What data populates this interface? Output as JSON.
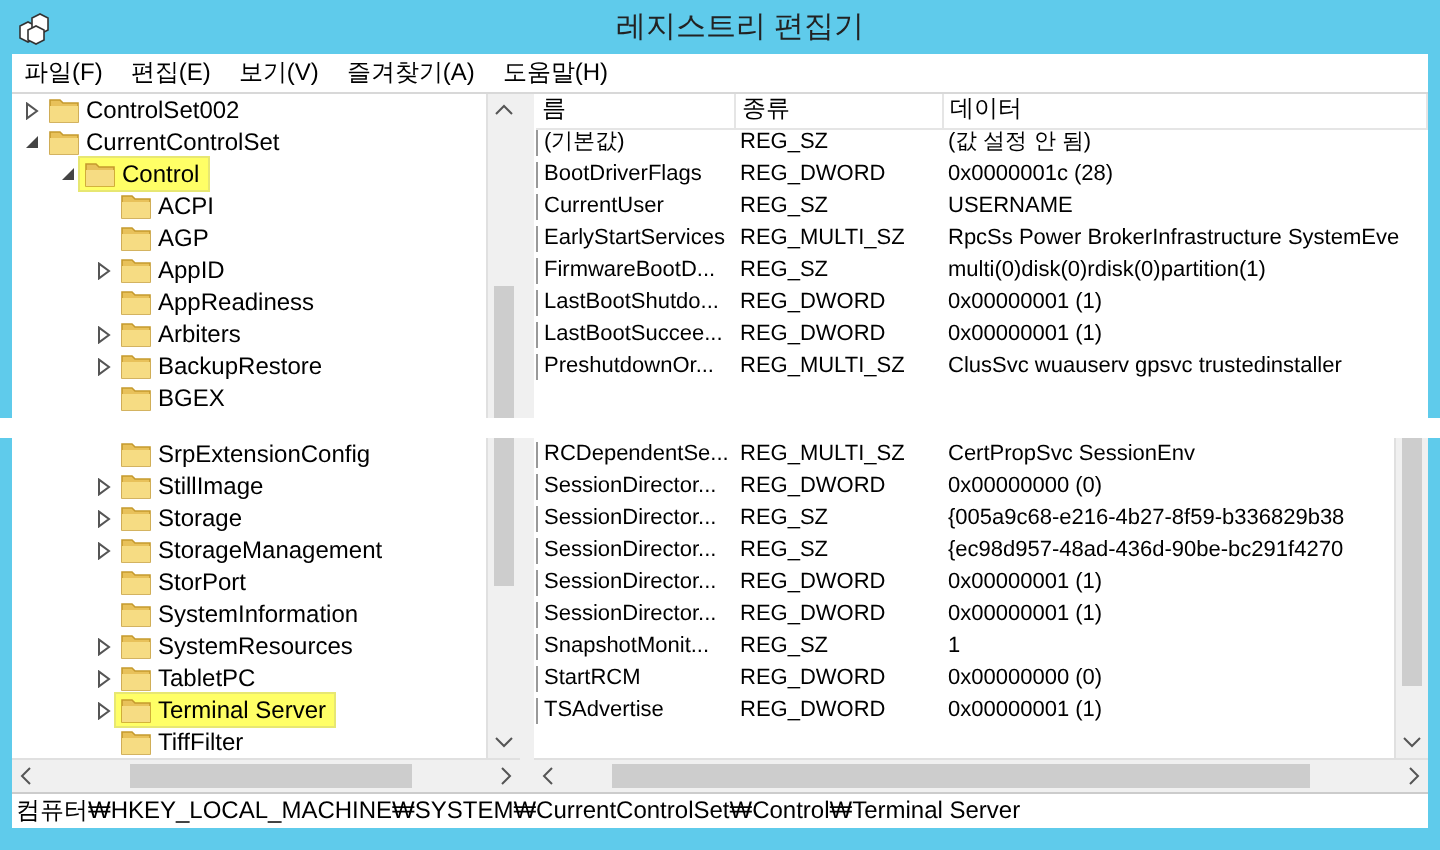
{
  "window": {
    "title": "레지스트리 편집기"
  },
  "menu": [
    "파일(F)",
    "편집(E)",
    "보기(V)",
    "즐겨찾기(A)",
    "도움말(H)"
  ],
  "tree": [
    {
      "kind": "branch",
      "label": "ControlSet002",
      "expanded": false,
      "highlighted": false
    },
    {
      "kind": "branch",
      "label": "CurrentControlSet",
      "expanded": true,
      "highlighted": false,
      "children": [
        {
          "kind": "branch",
          "label": "Control",
          "expanded": true,
          "highlighted": true,
          "children": [
            {
              "kind": "leaf",
              "label": "ACPI",
              "highlighted": false
            },
            {
              "kind": "leaf",
              "label": "AGP",
              "highlighted": false
            },
            {
              "kind": "branch",
              "label": "AppID",
              "expanded": false,
              "highlighted": false
            },
            {
              "kind": "leaf",
              "label": "AppReadiness",
              "highlighted": false
            },
            {
              "kind": "branch",
              "label": "Arbiters",
              "expanded": false,
              "highlighted": false
            },
            {
              "kind": "branch",
              "label": "BackupRestore",
              "expanded": false,
              "highlighted": false
            },
            {
              "kind": "leaf",
              "label": "BGEX",
              "highlighted": false
            },
            {
              "kind": "break"
            },
            {
              "kind": "leaf",
              "label": "SrpExtensionConfig",
              "highlighted": false
            },
            {
              "kind": "branch",
              "label": "StillImage",
              "expanded": false,
              "highlighted": false
            },
            {
              "kind": "branch",
              "label": "Storage",
              "expanded": false,
              "highlighted": false
            },
            {
              "kind": "branch",
              "label": "StorageManagement",
              "expanded": false,
              "highlighted": false
            },
            {
              "kind": "leaf",
              "label": "StorPort",
              "highlighted": false
            },
            {
              "kind": "leaf",
              "label": "SystemInformation",
              "highlighted": false
            },
            {
              "kind": "branch",
              "label": "SystemResources",
              "expanded": false,
              "highlighted": false
            },
            {
              "kind": "branch",
              "label": "TabletPC",
              "expanded": false,
              "highlighted": false
            },
            {
              "kind": "branch",
              "label": "Terminal Server",
              "expanded": false,
              "highlighted": true
            },
            {
              "kind": "leaf",
              "label": "TiffFilter",
              "highlighted": false
            }
          ]
        }
      ]
    }
  ],
  "table": {
    "columns": [
      "름",
      "종류",
      "데이터"
    ],
    "rows": [
      {
        "kind": "value",
        "name": "(기본값)",
        "type": "REG_SZ",
        "data": "(값 설정 안 됨)"
      },
      {
        "kind": "value",
        "name": "BootDriverFlags",
        "type": "REG_DWORD",
        "data": "0x0000001c (28)"
      },
      {
        "kind": "value",
        "name": "CurrentUser",
        "type": "REG_SZ",
        "data": "USERNAME"
      },
      {
        "kind": "value",
        "name": "EarlyStartServices",
        "type": "REG_MULTI_SZ",
        "data": "RpcSs Power BrokerInfrastructure SystemEve"
      },
      {
        "kind": "value",
        "name": "FirmwareBootD...",
        "type": "REG_SZ",
        "data": "multi(0)disk(0)rdisk(0)partition(1)"
      },
      {
        "kind": "value",
        "name": "LastBootShutdo...",
        "type": "REG_DWORD",
        "data": "0x00000001 (1)"
      },
      {
        "kind": "value",
        "name": "LastBootSuccee...",
        "type": "REG_DWORD",
        "data": "0x00000001 (1)"
      },
      {
        "kind": "value",
        "name": "PreshutdownOr...",
        "type": "REG_MULTI_SZ",
        "data": "ClusSvc wuauserv gpsvc trustedinstaller"
      },
      {
        "kind": "break"
      },
      {
        "kind": "value",
        "name": "RCDependentSe...",
        "type": "REG_MULTI_SZ",
        "data": "CertPropSvc SessionEnv"
      },
      {
        "kind": "value",
        "name": "SessionDirector...",
        "type": "REG_DWORD",
        "data": "0x00000000 (0)"
      },
      {
        "kind": "value",
        "name": "SessionDirector...",
        "type": "REG_SZ",
        "data": "{005a9c68-e216-4b27-8f59-b336829b38"
      },
      {
        "kind": "value",
        "name": "SessionDirector...",
        "type": "REG_SZ",
        "data": "{ec98d957-48ad-436d-90be-bc291f4270"
      },
      {
        "kind": "value",
        "name": "SessionDirector...",
        "type": "REG_DWORD",
        "data": "0x00000001 (1)"
      },
      {
        "kind": "value",
        "name": "SessionDirector...",
        "type": "REG_DWORD",
        "data": "0x00000001 (1)"
      },
      {
        "kind": "value",
        "name": "SnapshotMonit...",
        "type": "REG_SZ",
        "data": "1"
      },
      {
        "kind": "value",
        "name": "StartRCM",
        "type": "REG_DWORD",
        "data": "0x00000000 (0)"
      },
      {
        "kind": "value",
        "name": "TSAdvertise",
        "type": "REG_DWORD",
        "data": "0x00000001 (1)"
      }
    ]
  },
  "status_bar": "컴퓨터₩HKEY_LOCAL_MACHINE₩SYSTEM₩CurrentControlSet₩Control₩Terminal Server"
}
